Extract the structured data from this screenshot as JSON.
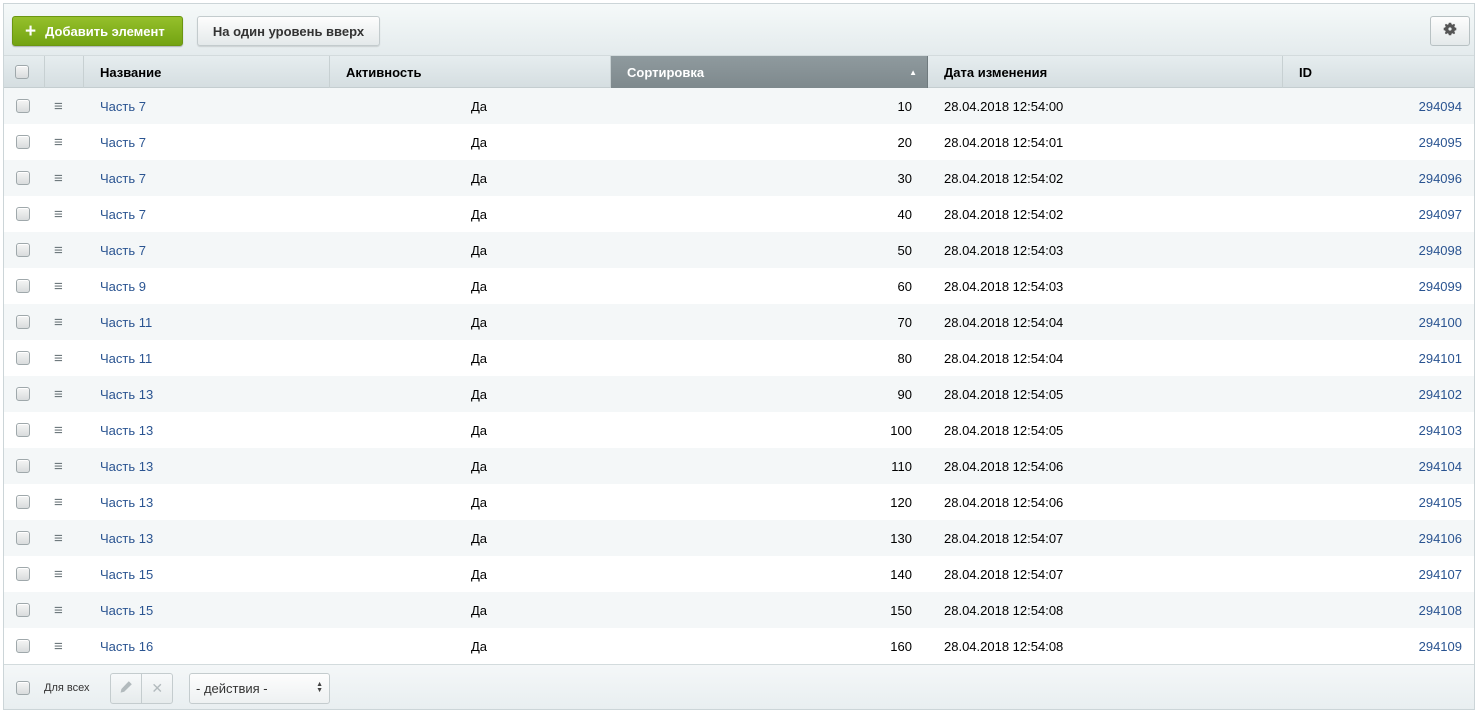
{
  "toolbar": {
    "add_label": "Добавить элемент",
    "up_label": "На один уровень вверх"
  },
  "table": {
    "columns": {
      "name": "Название",
      "active": "Активность",
      "sort": "Сортировка",
      "date": "Дата изменения",
      "id": "ID"
    },
    "sort_direction": "ascending",
    "rows": [
      {
        "name": "Часть 7",
        "active": "Да",
        "sort": "10",
        "date": "28.04.2018 12:54:00",
        "id": "294094"
      },
      {
        "name": "Часть 7",
        "active": "Да",
        "sort": "20",
        "date": "28.04.2018 12:54:01",
        "id": "294095"
      },
      {
        "name": "Часть 7",
        "active": "Да",
        "sort": "30",
        "date": "28.04.2018 12:54:02",
        "id": "294096"
      },
      {
        "name": "Часть 7",
        "active": "Да",
        "sort": "40",
        "date": "28.04.2018 12:54:02",
        "id": "294097"
      },
      {
        "name": "Часть 7",
        "active": "Да",
        "sort": "50",
        "date": "28.04.2018 12:54:03",
        "id": "294098"
      },
      {
        "name": "Часть 9",
        "active": "Да",
        "sort": "60",
        "date": "28.04.2018 12:54:03",
        "id": "294099"
      },
      {
        "name": "Часть 11",
        "active": "Да",
        "sort": "70",
        "date": "28.04.2018 12:54:04",
        "id": "294100"
      },
      {
        "name": "Часть 11",
        "active": "Да",
        "sort": "80",
        "date": "28.04.2018 12:54:04",
        "id": "294101"
      },
      {
        "name": "Часть 13",
        "active": "Да",
        "sort": "90",
        "date": "28.04.2018 12:54:05",
        "id": "294102"
      },
      {
        "name": "Часть 13",
        "active": "Да",
        "sort": "100",
        "date": "28.04.2018 12:54:05",
        "id": "294103"
      },
      {
        "name": "Часть 13",
        "active": "Да",
        "sort": "110",
        "date": "28.04.2018 12:54:06",
        "id": "294104"
      },
      {
        "name": "Часть 13",
        "active": "Да",
        "sort": "120",
        "date": "28.04.2018 12:54:06",
        "id": "294105"
      },
      {
        "name": "Часть 13",
        "active": "Да",
        "sort": "130",
        "date": "28.04.2018 12:54:07",
        "id": "294106"
      },
      {
        "name": "Часть 15",
        "active": "Да",
        "sort": "140",
        "date": "28.04.2018 12:54:07",
        "id": "294107"
      },
      {
        "name": "Часть 15",
        "active": "Да",
        "sort": "150",
        "date": "28.04.2018 12:54:08",
        "id": "294108"
      },
      {
        "name": "Часть 16",
        "active": "Да",
        "sort": "160",
        "date": "28.04.2018 12:54:08",
        "id": "294109"
      }
    ]
  },
  "footer": {
    "for_all_label": "Для всех",
    "actions_select": "- действия -"
  },
  "icons": {
    "add": "plus-icon",
    "settings": "gear-icon",
    "row_menu": "hamburger-menu-icon",
    "edit": "pencil-icon",
    "delete": "close-icon",
    "sort": "sort-ascending-arrow-icon"
  },
  "colors": {
    "add_button": "#7fae1c",
    "link": "#2a5491",
    "sorted_header": "#87929a"
  }
}
